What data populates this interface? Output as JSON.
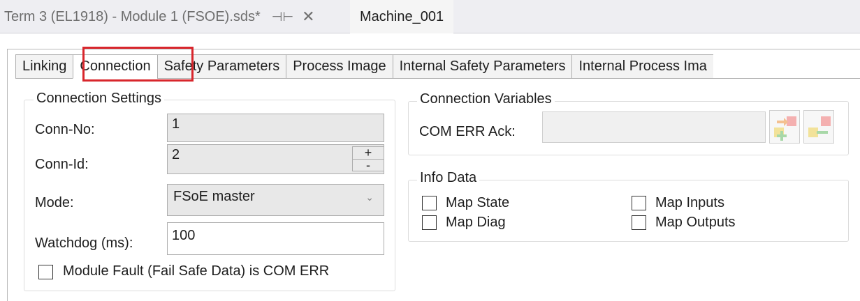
{
  "doc_tabs": {
    "inactive_title": "Term 3 (EL1918) - Module 1 (FSOE).sds*",
    "pin_icon": "⊣⊢",
    "close_icon": "✕",
    "active_title": "Machine_001"
  },
  "property_tabs": [
    {
      "label": "Linking"
    },
    {
      "label": "Connection"
    },
    {
      "label": "Safety Parameters"
    },
    {
      "label": "Process Image"
    },
    {
      "label": "Internal Safety Parameters"
    },
    {
      "label": "Internal Process Ima"
    }
  ],
  "connection_settings": {
    "title": "Connection Settings",
    "conn_no_label": "Conn-No:",
    "conn_no_value": "1",
    "conn_id_label": "Conn-Id:",
    "conn_id_value": "2",
    "spin_up": "+",
    "spin_down": "-",
    "mode_label": "Mode:",
    "mode_value": "FSoE master",
    "mode_chevron": "⌄",
    "watchdog_label": "Watchdog (ms):",
    "watchdog_value": "100",
    "module_fault_label": "Module Fault (Fail Safe Data) is COM ERR"
  },
  "connection_variables": {
    "title": "Connection Variables",
    "com_err_ack_label": "COM ERR Ack:",
    "com_err_ack_value": ""
  },
  "info_data": {
    "title": "Info Data",
    "map_state": "Map State",
    "map_diag": "Map Diag",
    "map_inputs": "Map Inputs",
    "map_outputs": "Map Outputs"
  }
}
